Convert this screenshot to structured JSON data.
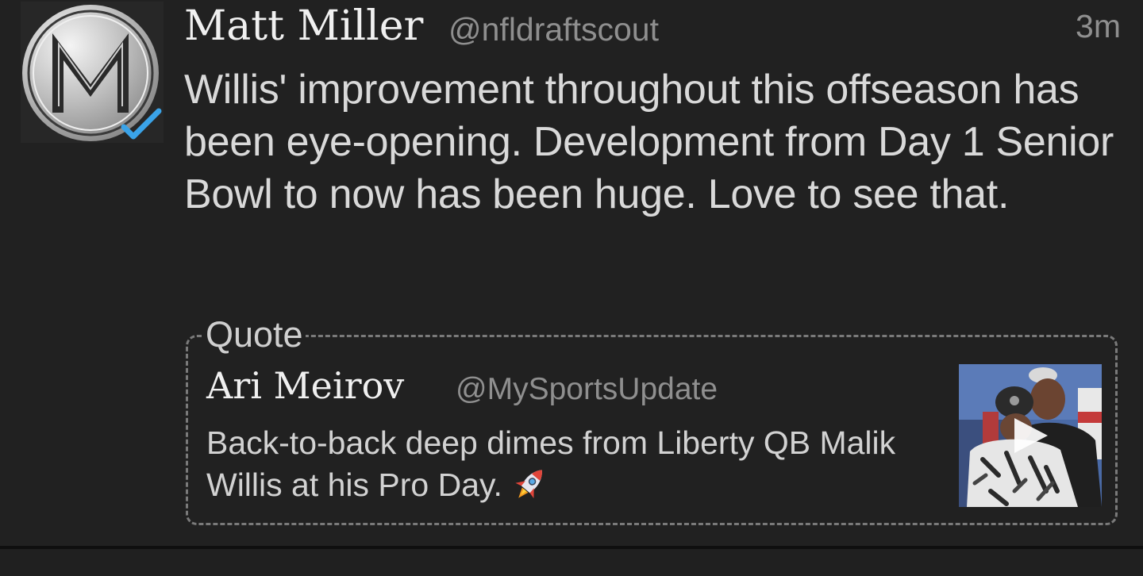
{
  "tweet": {
    "author_name": "Matt Miller",
    "author_handle": "@nfldraftscout",
    "timestamp": "3m",
    "text": "Willis' improvement throughout this offseason has been eye-opening. Development from Day 1 Senior Bowl to now has been huge. Love to see that.",
    "avatar_letter": "M",
    "verified": true,
    "verified_icon": "verified-check-icon",
    "colors": {
      "background": "#212121",
      "name": "#f0f0f0",
      "handle": "#8f8f8f",
      "text": "#d9d9d9",
      "verified": "#3aa3e8"
    }
  },
  "quote": {
    "label": "Quote",
    "author_name": "Ari Meirov",
    "author_handle": "@MySportsUpdate",
    "text": "Back-to-back deep dimes from Liberty QB Malik Willis at his Pro Day.",
    "emoji_icon": "rocket-icon",
    "media": {
      "type": "video",
      "play_icon": "play-icon"
    }
  }
}
